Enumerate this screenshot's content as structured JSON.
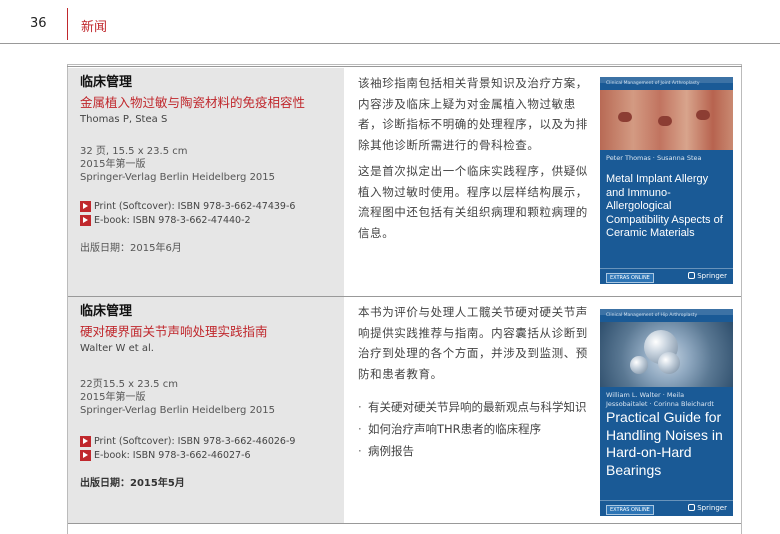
{
  "header": {
    "page_number": "36",
    "section": "新闻"
  },
  "books": [
    {
      "category": "临床管理",
      "title": "金属植入物过敏与陶瓷材料的免疫相容性",
      "authors": "Thomas P, Stea S",
      "pages_size": "32 页, 15.5 x 23.5 cm",
      "edition": "2015年第一版",
      "publisher": "Springer-Verlag Berlin Heidelberg 2015",
      "isbn_print": "Print (Softcover): ISBN 978-3-662-47439-6",
      "isbn_ebook": "E-book: ISBN 978-3-662-47440-2",
      "date": "出版日期：2015年6月",
      "description": [
        "该袖珍指南包括相关背景知识及治疗方案，内容涉及临床上疑为对金属植入物过敏患者，诊断指标不明确的处理程序，以及为排除其他诊断所需进行的骨科检查。",
        "这是首次拟定出一个临床实践程序，供疑似植入物过敏时使用。程序以层样结构展示，流程图中还包括有关组织病理和颗粒病理的信息。"
      ],
      "cover": {
        "series": "Clinical Management of Joint Arthroplasty",
        "authors": "Peter Thomas · Susanna Stea",
        "title": "Metal Implant Allergy and Immuno-Allergological Compatibility Aspects of Ceramic Materials",
        "badge": "EXTRAS ONLINE",
        "publisher": "Springer",
        "color": "#1a5a96"
      }
    },
    {
      "category": "临床管理",
      "title": "硬对硬界面关节声响处理实践指南",
      "authors": "Walter W et al.",
      "pages_size": "22页15.5 x 23.5 cm",
      "edition": "2015年第一版",
      "publisher": "Springer-Verlag Berlin Heidelberg 2015",
      "isbn_print": "Print (Softcover): ISBN 978-3-662-46026-9",
      "isbn_ebook": "E-book: ISBN 978-3-662-46027-6",
      "date": "出版日期：2015年5月",
      "description": [
        "本书为评价与处理人工髋关节硬对硬关节声响提供实践推荐与指南。内容囊括从诊断到治疗到处理的各个方面，并涉及到监测、预防和患者教育。"
      ],
      "bullets": [
        "有关硬对硬关节异响的最新观点与科学知识",
        "如何治疗声响THR患者的临床程序",
        "病例报告"
      ],
      "cover": {
        "series": "Clinical Management of Hip Arthroplasty",
        "authors": "William L. Walter · Meila Jessobaitalet · Corinna Bleichardt",
        "title": "Practical Guide for Handling Noises in Hard-on-Hard Bearings",
        "badge": "EXTRAS ONLINE",
        "publisher": "Springer",
        "color": "#1a5a96"
      }
    }
  ]
}
